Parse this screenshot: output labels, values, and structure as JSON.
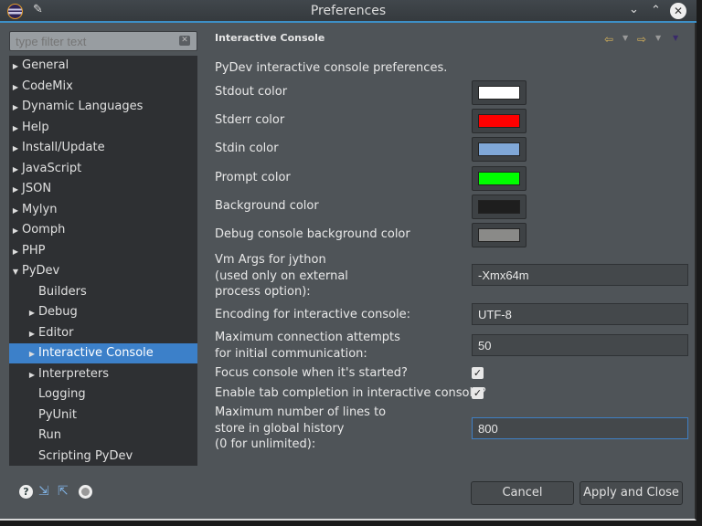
{
  "window": {
    "title": "Preferences"
  },
  "filter": {
    "placeholder": "type filter text"
  },
  "tree": [
    {
      "label": "General",
      "level": 0,
      "arrow": "right"
    },
    {
      "label": "CodeMix",
      "level": 0,
      "arrow": "right"
    },
    {
      "label": "Dynamic Languages",
      "level": 0,
      "arrow": "right"
    },
    {
      "label": "Help",
      "level": 0,
      "arrow": "right"
    },
    {
      "label": "Install/Update",
      "level": 0,
      "arrow": "right"
    },
    {
      "label": "JavaScript",
      "level": 0,
      "arrow": "right"
    },
    {
      "label": "JSON",
      "level": 0,
      "arrow": "right"
    },
    {
      "label": "Mylyn",
      "level": 0,
      "arrow": "right"
    },
    {
      "label": "Oomph",
      "level": 0,
      "arrow": "right"
    },
    {
      "label": "PHP",
      "level": 0,
      "arrow": "right"
    },
    {
      "label": "PyDev",
      "level": 0,
      "arrow": "down"
    },
    {
      "label": "Builders",
      "level": 1,
      "arrow": ""
    },
    {
      "label": "Debug",
      "level": 1,
      "arrow": "right"
    },
    {
      "label": "Editor",
      "level": 1,
      "arrow": "right"
    },
    {
      "label": "Interactive Console",
      "level": 1,
      "arrow": "right",
      "selected": true
    },
    {
      "label": "Interpreters",
      "level": 1,
      "arrow": "right"
    },
    {
      "label": "Logging",
      "level": 1,
      "arrow": ""
    },
    {
      "label": "PyUnit",
      "level": 1,
      "arrow": ""
    },
    {
      "label": "Run",
      "level": 1,
      "arrow": ""
    },
    {
      "label": "Scripting PyDev",
      "level": 1,
      "arrow": ""
    }
  ],
  "page": {
    "title": "Interactive Console",
    "description": "PyDev interactive console preferences.",
    "colors": [
      {
        "label": "Stdout color",
        "color": "#ffffff"
      },
      {
        "label": "Stderr color",
        "color": "#ff0000"
      },
      {
        "label": "Stdin color",
        "color": "#80a8d8"
      },
      {
        "label": "Prompt color",
        "color": "#00ff00"
      },
      {
        "label": "Background color",
        "color": "#1e1e1e"
      },
      {
        "label": "Debug console background color",
        "color": "#8a8a88"
      }
    ],
    "vm_args": {
      "label_lines": [
        "Vm Args for jython",
        "(used only on external",
        "process option):"
      ],
      "value": "-Xmx64m"
    },
    "encoding": {
      "label": "Encoding for interactive console:",
      "value": "UTF-8"
    },
    "max_conn": {
      "label_lines": [
        "Maximum connection attempts",
        "for initial communication:"
      ],
      "value": "50"
    },
    "focus": {
      "label": "Focus console when it's started?",
      "checked": true
    },
    "tab_completion": {
      "label": "Enable tab completion in interactive console?",
      "checked": true
    },
    "history": {
      "label_lines": [
        "Maximum number of lines to",
        "store in global history",
        "(0 for unlimited):"
      ],
      "value": "800"
    }
  },
  "buttons": {
    "cancel": "Cancel",
    "apply_close": "Apply and Close"
  }
}
